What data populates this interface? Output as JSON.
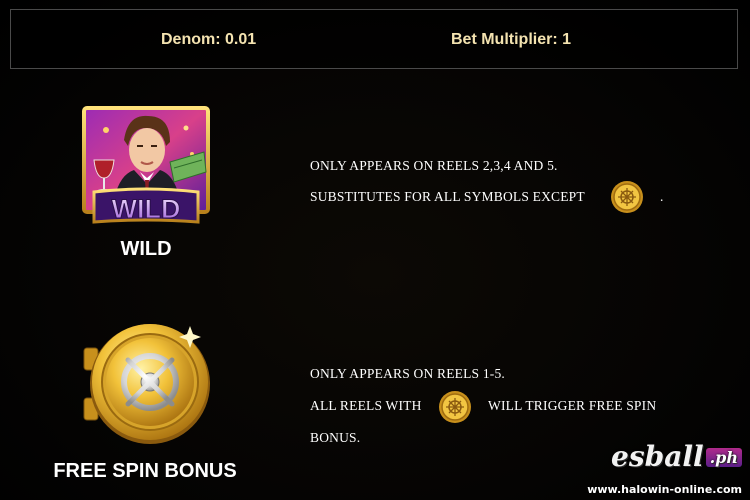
{
  "header": {
    "denom": "Denom: 0.01",
    "bet_multiplier": "Bet Multiplier: 1"
  },
  "wild": {
    "badge_text": "WILD",
    "label": "WILD",
    "line1": "ONLY APPEARS ON REELS 2,3,4 AND 5.",
    "line2": "SUBSTITUTES FOR ALL SYMBOLS EXCEPT",
    "line2_end": ".",
    "inline_icon": "vault-coin-icon"
  },
  "free_spin": {
    "label": "FREE SPIN BONUS",
    "line1": "ONLY APPEARS ON REELS 1-5.",
    "line2_start": "ALL REELS WITH",
    "line2_end": "WILL TRIGGER FREE SPIN",
    "line3": "BONUS.",
    "symbol_icon": "vault-coin-icon"
  },
  "watermark": {
    "logo": "esball",
    "logo_suffix": ".ph",
    "url": "www.halowin-online.com"
  },
  "colors": {
    "header_text": "#f4e3b0",
    "gold": "#e8b52a",
    "wild_purple": "#6c2bb0"
  }
}
